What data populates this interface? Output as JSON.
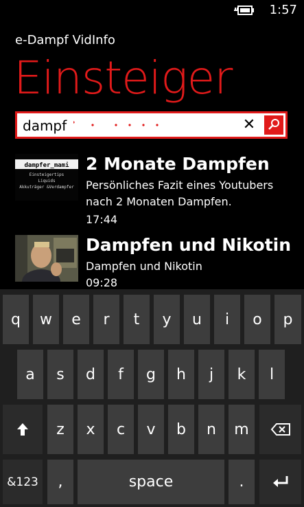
{
  "status_bar": {
    "time": "1:57",
    "battery_icon": "battery-charging-icon"
  },
  "app": {
    "name": "e-Dampf VidInfo",
    "page_title": "Einsteiger",
    "accent": "#e11a1a"
  },
  "search": {
    "value": "dampf",
    "clear_icon": "close-icon",
    "search_icon": "search-icon"
  },
  "results": [
    {
      "title": "2 Monate Dampfen",
      "description": "Persönliches Fazit eines Youtubers nach 2 Monaten Dampfen.",
      "duration": "17:44",
      "thumb_lines": [
        "dampfer_mami",
        "Einsteigertips",
        "Liquids",
        "Akkuträger &Verdampfer"
      ]
    },
    {
      "title": "Dampfen und Nikotin",
      "description": "Dampfen und Nikotin",
      "duration": "09:28"
    }
  ],
  "keyboard": {
    "row1": [
      "q",
      "w",
      "e",
      "r",
      "t",
      "y",
      "u",
      "i",
      "o",
      "p"
    ],
    "row2": [
      "a",
      "s",
      "d",
      "f",
      "g",
      "h",
      "j",
      "k",
      "l"
    ],
    "row3": [
      "z",
      "x",
      "c",
      "v",
      "b",
      "n",
      "m"
    ],
    "shift_icon": "shift-arrow-icon",
    "backspace_icon": "backspace-icon",
    "numbers_label": "&123",
    "comma_label": ",",
    "space_label": "space",
    "period_label": ".",
    "enter_icon": "enter-icon"
  }
}
